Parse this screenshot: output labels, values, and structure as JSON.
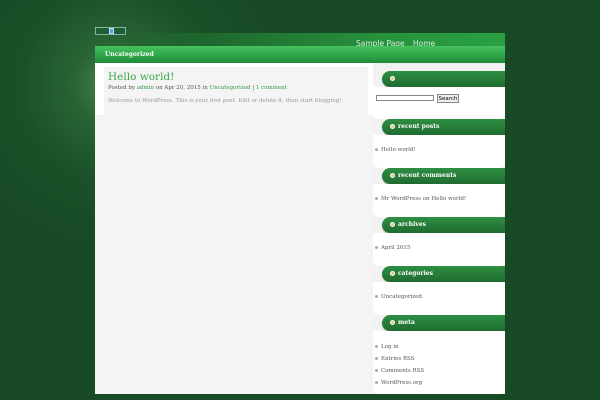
{
  "nav": {
    "items": [
      "Sample Page",
      "Home"
    ]
  },
  "category_bar": {
    "label": "Uncategorized"
  },
  "post": {
    "title": "Hello world!",
    "meta_posted_by": "Posted by",
    "meta_author": "admin",
    "meta_on": "on Apr 20, 2015 in",
    "meta_category": "Uncategorized",
    "meta_sep": "|",
    "meta_comments": "1 comment",
    "excerpt": "Welcome to WordPress. This is your first post. Edit or delete it, then start blogging!"
  },
  "search": {
    "button_label": "Search",
    "value": ""
  },
  "widgets": [
    {
      "title": "recent posts",
      "items": [
        "Hello world!"
      ]
    },
    {
      "title": "recent comments",
      "items": [
        "Mr WordPress on Hello world!"
      ]
    },
    {
      "title": "archives",
      "items": [
        "April 2015"
      ]
    },
    {
      "title": "categories",
      "items": [
        "Uncategorized"
      ]
    },
    {
      "title": "meta",
      "items": [
        "Log in",
        "Entries RSS",
        "Comments RSS",
        "WordPress.org"
      ]
    }
  ],
  "colors": {
    "accent": "#2fa548",
    "link": "#2e9a44",
    "background": "#174a25"
  }
}
